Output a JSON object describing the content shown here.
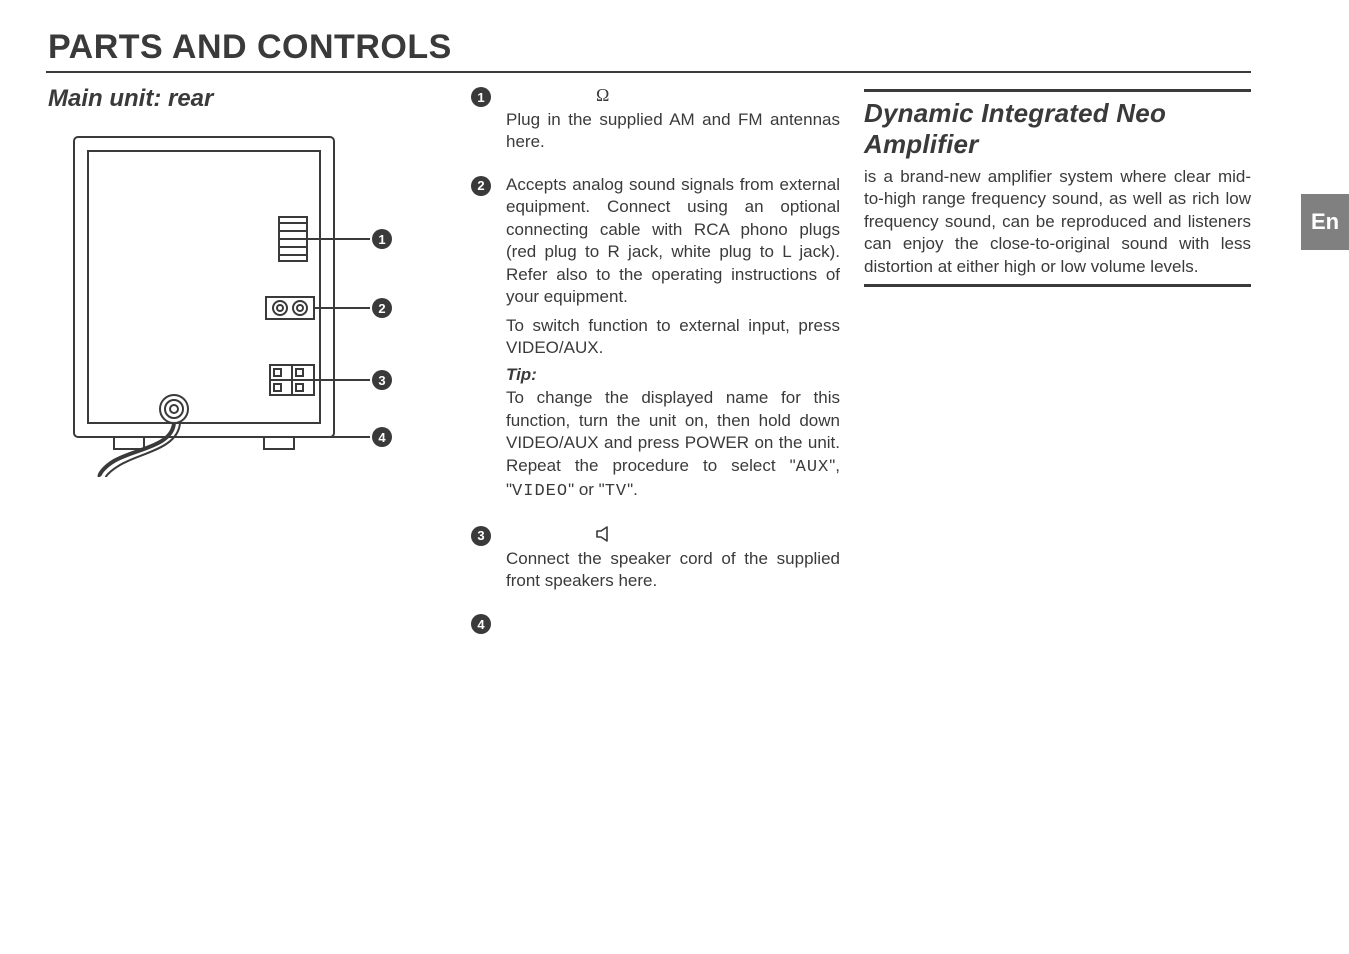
{
  "lang_tab": "En",
  "title": "PARTS AND CONTROLS",
  "left": {
    "heading": "Main unit: rear",
    "callouts": [
      "1",
      "2",
      "3",
      "4"
    ]
  },
  "mid": {
    "items": [
      {
        "num": "1",
        "symbol_name": "ohm-symbol",
        "symbol_text": "Ω",
        "paragraphs": [
          "Plug in the supplied AM and FM antennas here."
        ]
      },
      {
        "num": "2",
        "paragraphs": [
          "Accepts analog sound signals from external equipment. Connect using an optional connecting cable with RCA phono plugs (red plug to R jack, white plug to L jack). Refer also to the operating instructions of your equipment.",
          "To switch function to external input, press VIDEO/AUX."
        ],
        "tip_label": "Tip:",
        "tip_text_pre": "To change the displayed name for this function, turn the unit on, then hold down VIDEO/AUX and press POWER on the unit. Repeat the procedure to select \"",
        "tip_opts": [
          "AUX",
          "VIDEO",
          "TV"
        ],
        "tip_sep1": "\", \"",
        "tip_sep2": "\" or \"",
        "tip_end": "\"."
      },
      {
        "num": "3",
        "symbol_name": "speaker-icon",
        "paragraphs": [
          "Connect the speaker cord of the supplied front speakers here."
        ]
      },
      {
        "num": "4",
        "paragraphs": []
      }
    ]
  },
  "right": {
    "heading": "Dynamic Integrated Neo Amplifier",
    "body": "is a brand-new amplifier system where clear mid-to-high range frequency sound, as well as rich low frequency sound, can be reproduced and listeners can enjoy the close-to-original sound with less distortion at either high or low volume levels."
  }
}
